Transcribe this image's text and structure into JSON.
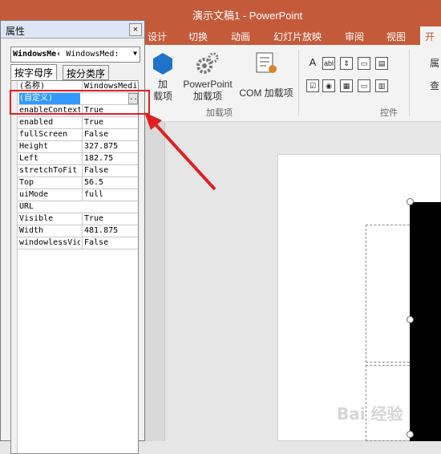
{
  "app": {
    "title": "演示文稿1 - PowerPoint"
  },
  "ribbon_tabs": [
    {
      "label": "设计",
      "active": false
    },
    {
      "label": "切换",
      "active": false
    },
    {
      "label": "动画",
      "active": false
    },
    {
      "label": "幻灯片放映",
      "active": false
    },
    {
      "label": "审阅",
      "active": false
    },
    {
      "label": "视图",
      "active": false
    },
    {
      "label": "开发",
      "active": true
    }
  ],
  "ribbon": {
    "addins_btn": {
      "line1": "加",
      "line2": "载项"
    },
    "ppt_addins_btn": {
      "line1": "PowerPoint",
      "line2": "加载项"
    },
    "com_addins_btn": {
      "label": "COM 加载项"
    },
    "addins_group": "加载项",
    "controls_group": "控件",
    "controls_icons": [
      "A",
      "abl",
      "⇕",
      "▭",
      "▤",
      "☑",
      "◉",
      "▦",
      "▭",
      "▥"
    ],
    "right_labels": [
      "属",
      "查"
    ]
  },
  "properties": {
    "title": "属性",
    "close_glyph": "×",
    "object_name": "WindowsMe‹",
    "object_type": "WindowsMed:",
    "tab_alpha": "按字母序",
    "tab_category": "按分类序",
    "rows": [
      {
        "key": "(名称)",
        "value": "WindowsMedi"
      },
      {
        "key": "(自定义)",
        "value": ""
      },
      {
        "key": "enableContext",
        "value": "True"
      },
      {
        "key": "enabled",
        "value": "True"
      },
      {
        "key": "fullScreen",
        "value": "False"
      },
      {
        "key": "Height",
        "value": "327.875"
      },
      {
        "key": "Left",
        "value": "182.75"
      },
      {
        "key": "stretchToFit",
        "value": "False"
      },
      {
        "key": "Top",
        "value": "56.5"
      },
      {
        "key": "uiMode",
        "value": "full"
      },
      {
        "key": "URL",
        "value": ""
      },
      {
        "key": "Visible",
        "value": "True"
      },
      {
        "key": "Width",
        "value": "481.875"
      },
      {
        "key": "windowlessVid",
        "value": "False"
      }
    ],
    "ellipsis": "..."
  },
  "watermark": "Bai 经验",
  "colors": {
    "accent": "#c55a3a",
    "highlight": "#e02020",
    "selection": "#3399ff"
  }
}
